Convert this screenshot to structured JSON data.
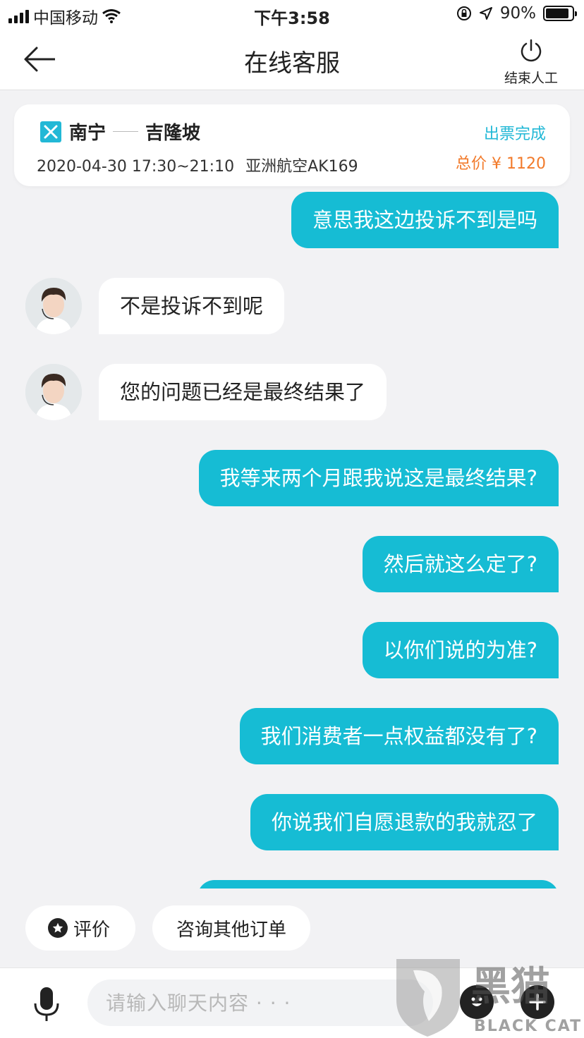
{
  "status_bar": {
    "carrier": "中国移动",
    "time": "下午3:58",
    "battery": "90%",
    "battery_level": 0.9
  },
  "nav": {
    "title": "在线客服",
    "end_label": "结束人工"
  },
  "flight_card": {
    "from": "南宁",
    "to": "吉隆坡",
    "datetime": "2020-04-30 17:30~21:10",
    "airline_flight": "亚洲航空AK169",
    "status": "出票完成",
    "price": "总价 ¥ 1120"
  },
  "messages": [
    {
      "side": "out",
      "text": "意思我这边投诉不到是吗"
    },
    {
      "side": "in",
      "text": "不是投诉不到呢"
    },
    {
      "side": "in",
      "text": "您的问题已经是最终结果了"
    },
    {
      "side": "out",
      "text": "我等来两个月跟我说这是最终结果?"
    },
    {
      "side": "out",
      "text": "然后就这么定了?"
    },
    {
      "side": "out",
      "text": "以你们说的为准?"
    },
    {
      "side": "out",
      "text": "我们消费者一点权益都没有了?"
    },
    {
      "side": "out",
      "text": "你说我们自愿退款的我就忍了"
    },
    {
      "side": "out",
      "text": ""
    }
  ],
  "quick_actions": {
    "rate_label": "评价",
    "other_orders_label": "咨询其他订单"
  },
  "input": {
    "placeholder": "请输入聊天内容 · · ·"
  },
  "watermark": {
    "text_cn": "黑猫",
    "text_en": "BLACK CAT"
  },
  "colors": {
    "accent": "#16bcd4",
    "price": "#f27a2a",
    "background": "#f2f2f4"
  }
}
